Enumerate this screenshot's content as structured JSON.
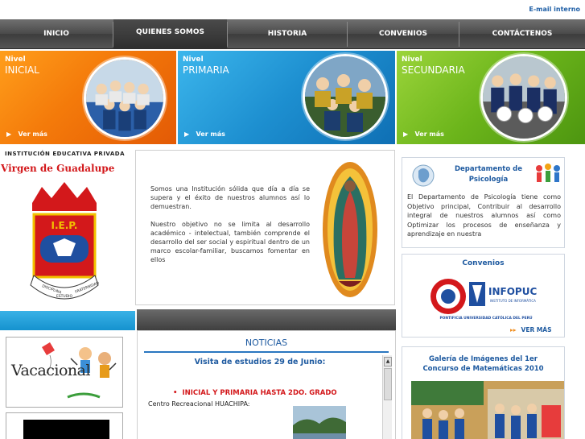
{
  "header": {
    "email_link": "E-mail interno"
  },
  "nav": {
    "items": [
      {
        "label": "INICIO"
      },
      {
        "label": "QUIENES SOMOS"
      },
      {
        "label": "HISTORIA"
      },
      {
        "label": "CONVENIOS"
      },
      {
        "label": "CONTÁCTENOS"
      }
    ],
    "active_index": 1
  },
  "banners": [
    {
      "level_label": "Nivel",
      "title": "INICIAL",
      "more": "Ver más",
      "color": "#f47a0a"
    },
    {
      "level_label": "Nivel",
      "title": "PRIMARIA",
      "more": "Ver más",
      "color": "#1d8fd0"
    },
    {
      "level_label": "Nivel",
      "title": "SECUNDARIA",
      "more": "Ver más",
      "color": "#6cb51b"
    }
  ],
  "brand": {
    "label": "INSTITUCIÓN EDUCATIVA PRIVADA",
    "name": "Virgen de Guadalupe",
    "logo_text": "I.E.P.",
    "motto": [
      "DISCIPLINA",
      "ESTUDIO",
      "FRATERNIDAD"
    ]
  },
  "intro": {
    "paragraph1": "Somos una Institución sólida que día a día se supera y el éxito de nuestros alumnos así lo demuestran.",
    "paragraph2": "Nuestro objetivo no se limita al desarrollo académico - intelectual, también comprende el desarrollo del ser social y espiritual dentro de un marco escolar-familiar, buscamos fomentar en ellos"
  },
  "psicologia": {
    "title": "Departamento de Psicología",
    "text": "El Departamento de Psicología tiene como Objetivo principal, Contribuir al desarrollo integral de nuestros alumnos así como Optimizar los procesos de enseñanza y aprendizaje en nuestra"
  },
  "convenios": {
    "title": "Convenios",
    "partner_name": "INFOPUC",
    "partner_sub": "INSTITUTO DE INFORMÁTICA",
    "university": "PONTIFICIA UNIVERSIDAD CATÓLICA DEL PERÚ",
    "more": "VER MÁS"
  },
  "vacacional": {
    "title": "Vacacional"
  },
  "noticias": {
    "title": "NOTICIAS",
    "headline": "Visita de estudios 29 de Junio:",
    "bullet": "INICIAL Y PRIMARIA HASTA 2DO. GRADO",
    "place": "Centro Recreacional HUACHIPA:"
  },
  "galeria": {
    "title_line1": "Galería de Imágenes del 1er",
    "title_line2": "Concurso de Matemáticas 2010"
  },
  "colors": {
    "nav_bg": "#4a4a4a",
    "link_blue": "#1e5aa0",
    "brand_red": "#d3181b",
    "strip_blue": "#1592cf"
  }
}
